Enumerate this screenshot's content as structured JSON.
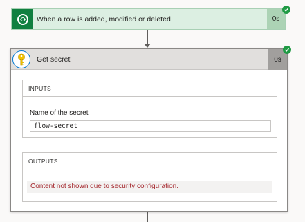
{
  "trigger": {
    "title": "When a row is added, modified or deleted",
    "duration": "0s",
    "icon": "dataverse-icon",
    "status": "succeeded",
    "color": "#108040"
  },
  "action": {
    "title": "Get secret",
    "duration": "0s",
    "icon": "key-icon",
    "status": "succeeded",
    "inputs": {
      "header": "INPUTS",
      "field_label": "Name of the secret",
      "field_value": "flow-secret"
    },
    "outputs": {
      "header": "OUTPUTS",
      "message": "Content not shown due to security configuration."
    }
  },
  "colors": {
    "success": "#1f9a44",
    "error_text": "#a4262c",
    "trigger_bg": "#dcefe2"
  }
}
